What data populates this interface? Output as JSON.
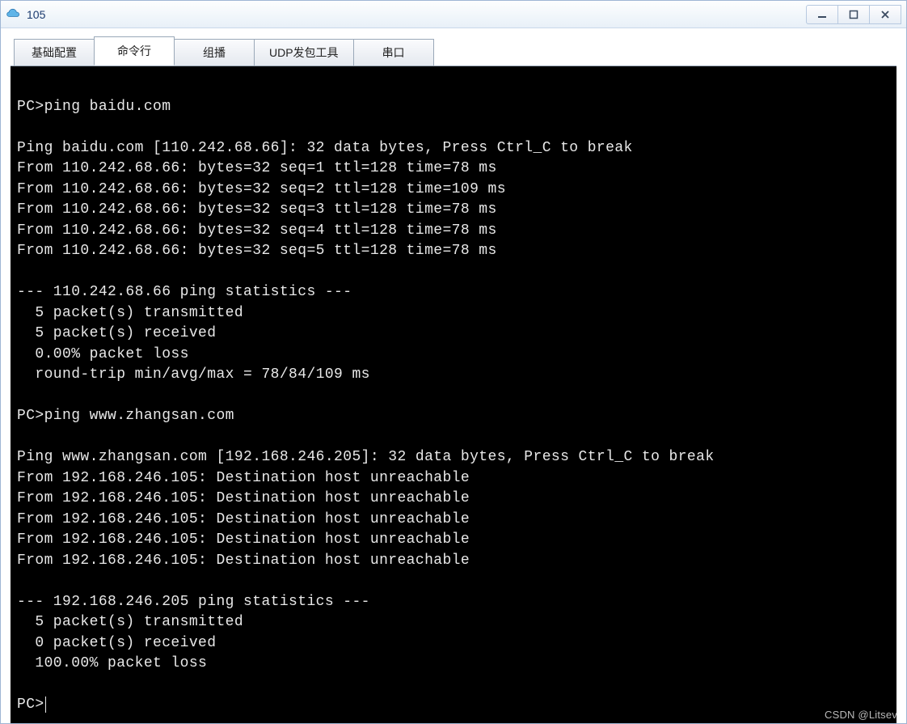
{
  "window": {
    "title": "105",
    "icon": "cloud-icon"
  },
  "window_controls": {
    "minimize": "—",
    "maximize": "▭",
    "close": "✕"
  },
  "tabs": [
    {
      "label": "基础配置",
      "active": false
    },
    {
      "label": "命令行",
      "active": true
    },
    {
      "label": "组播",
      "active": false
    },
    {
      "label": "UDP发包工具",
      "active": false
    },
    {
      "label": "串口",
      "active": false
    }
  ],
  "terminal": {
    "prompt": "PC>",
    "lines": [
      "",
      "PC>ping baidu.com",
      "",
      "Ping baidu.com [110.242.68.66]: 32 data bytes, Press Ctrl_C to break",
      "From 110.242.68.66: bytes=32 seq=1 ttl=128 time=78 ms",
      "From 110.242.68.66: bytes=32 seq=2 ttl=128 time=109 ms",
      "From 110.242.68.66: bytes=32 seq=3 ttl=128 time=78 ms",
      "From 110.242.68.66: bytes=32 seq=4 ttl=128 time=78 ms",
      "From 110.242.68.66: bytes=32 seq=5 ttl=128 time=78 ms",
      "",
      "--- 110.242.68.66 ping statistics ---",
      "  5 packet(s) transmitted",
      "  5 packet(s) received",
      "  0.00% packet loss",
      "  round-trip min/avg/max = 78/84/109 ms",
      "",
      "PC>ping www.zhangsan.com",
      "",
      "Ping www.zhangsan.com [192.168.246.205]: 32 data bytes, Press Ctrl_C to break",
      "From 192.168.246.105: Destination host unreachable",
      "From 192.168.246.105: Destination host unreachable",
      "From 192.168.246.105: Destination host unreachable",
      "From 192.168.246.105: Destination host unreachable",
      "From 192.168.246.105: Destination host unreachable",
      "",
      "--- 192.168.246.205 ping statistics ---",
      "  5 packet(s) transmitted",
      "  0 packet(s) received",
      "  100.00% packet loss",
      "",
      "PC>"
    ]
  },
  "watermark": "CSDN @Litsev"
}
